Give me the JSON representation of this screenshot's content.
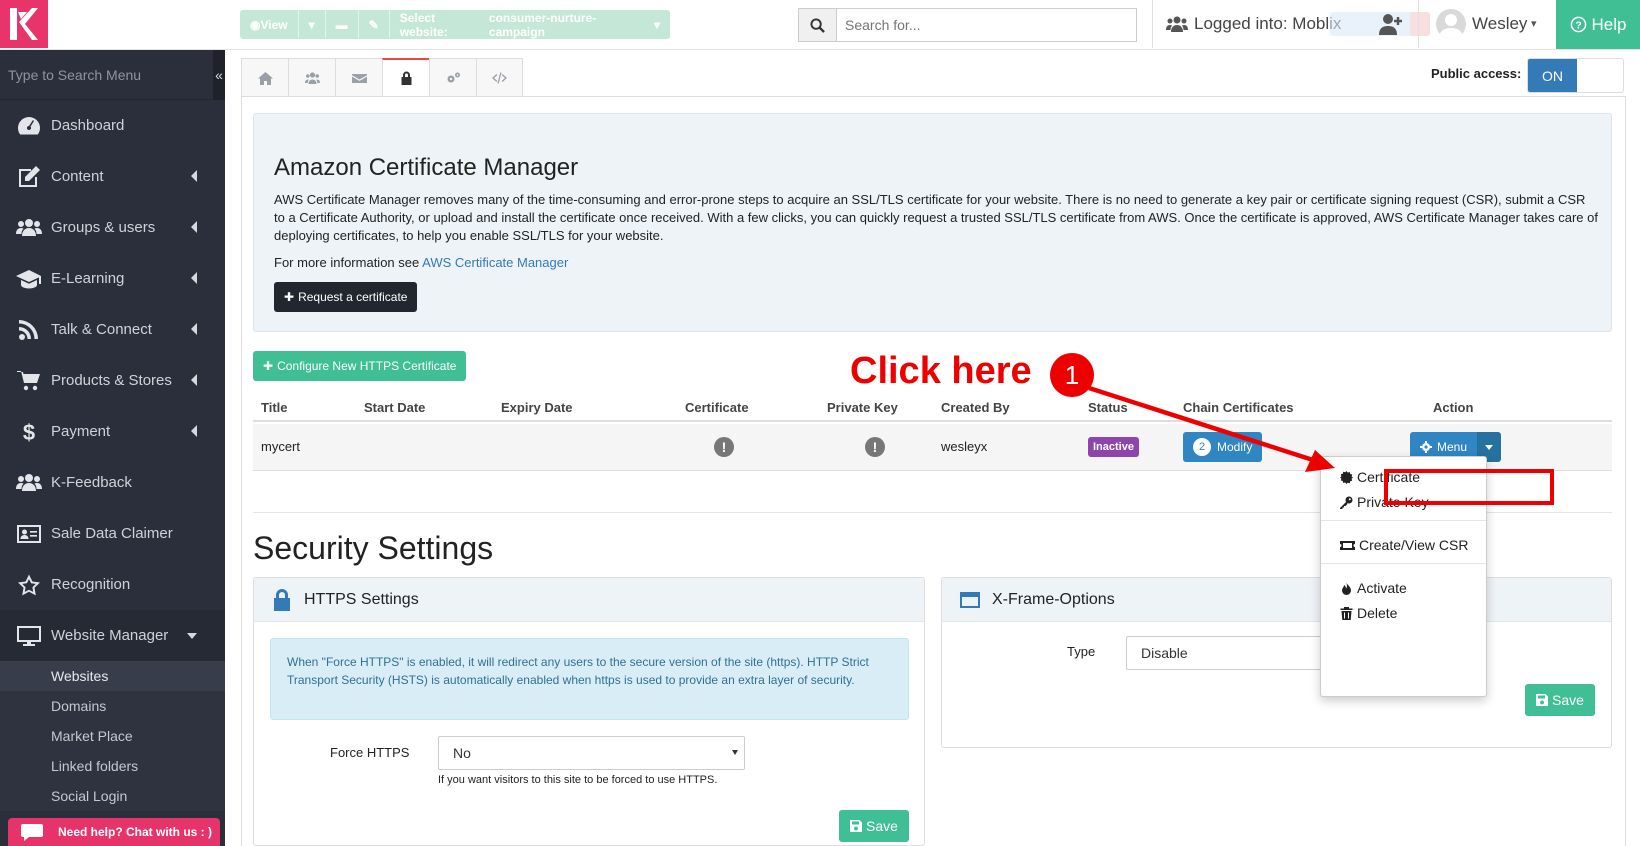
{
  "topbar": {
    "view_label": "View",
    "select_website_label": "Select website:",
    "select_website_value": "consumer-nurture-campaign",
    "search_placeholder": "Search for...",
    "logged_into": "Logged into: Moblix",
    "user_name": "Wesley",
    "help_label": "Help"
  },
  "sidebar": {
    "search_placeholder": "Type to Search Menu",
    "items": [
      {
        "label": "Dashboard",
        "icon": "dashboard-icon"
      },
      {
        "label": "Content",
        "icon": "edit-icon"
      },
      {
        "label": "Groups & users",
        "icon": "users-icon"
      },
      {
        "label": "E-Learning",
        "icon": "graduation-cap-icon"
      },
      {
        "label": "Talk & Connect",
        "icon": "rss-icon"
      },
      {
        "label": "Products & Stores",
        "icon": "cart-icon"
      },
      {
        "label": "Payment",
        "icon": "dollar-icon"
      },
      {
        "label": "K-Feedback",
        "icon": "users-icon"
      },
      {
        "label": "Sale Data Claimer",
        "icon": "id-card-icon"
      },
      {
        "label": "Recognition",
        "icon": "star-icon"
      },
      {
        "label": "Website Manager",
        "icon": "monitor-icon"
      }
    ],
    "sub_items": [
      "Websites",
      "Domains",
      "Market Place",
      "Linked folders",
      "Social Login"
    ],
    "chat_label": "Need help? Chat with us : )"
  },
  "main": {
    "public_access_label": "Public access:",
    "public_access_on": "ON",
    "acm": {
      "title": "Amazon Certificate Manager",
      "description": "AWS Certificate Manager removes many of the time-consuming and error-prone steps to acquire an SSL/TLS certificate for your website. There is no need to generate a key pair or certificate signing request (CSR), submit a CSR to a Certificate Authority, or upload and install the certificate once received. With a few clicks, you can quickly request a trusted SSL/TLS certificate from AWS. Once the certificate is approved, AWS Certificate Manager takes care of deploying certificates, to help you enable SSL/TLS for your website.",
      "more_info_prefix": "For more information see ",
      "more_info_link": "AWS Certificate Manager",
      "request_button": "Request a certificate"
    },
    "configure_button": "Configure New HTTPS Certificate",
    "annotation": {
      "text": "Click here",
      "number": "1"
    },
    "table": {
      "headers": [
        "Title",
        "Start Date",
        "Expiry Date",
        "Certificate",
        "Private Key",
        "Created By",
        "Status",
        "Chain Certificates",
        "Action"
      ],
      "row": {
        "title": "mycert",
        "start_date": "",
        "expiry_date": "",
        "created_by": "wesleyx",
        "status": "Inactive",
        "chain_count": "2",
        "modify_label": "Modify",
        "menu_label": "Menu"
      }
    },
    "dropdown": {
      "certificate": "Certificate",
      "private_key": "Private Key",
      "create_csr": "Create/View CSR",
      "activate": "Activate",
      "delete": "Delete"
    },
    "security": {
      "title": "Security Settings",
      "https_panel": {
        "title": "HTTPS Settings",
        "info": "When \"Force HTTPS\" is enabled, it will redirect any users to the secure version of the site (https). HTTP Strict Transport Security (HSTS) is automatically enabled when https is used to provide an extra layer of security.",
        "force_label": "Force HTTPS",
        "force_value": "No",
        "force_help": "If you want visitors to this site to be forced to use HTTPS.",
        "save": "Save"
      },
      "xframe_panel": {
        "title": "X-Frame-Options",
        "type_label": "Type",
        "type_value": "Disable",
        "save": "Save"
      }
    }
  },
  "colors": {
    "brand_pink": "#e8336b",
    "green": "#3fbf93",
    "blue": "#337ab7",
    "annotation_red": "#ee0000",
    "status_purple": "#8e44ad"
  }
}
